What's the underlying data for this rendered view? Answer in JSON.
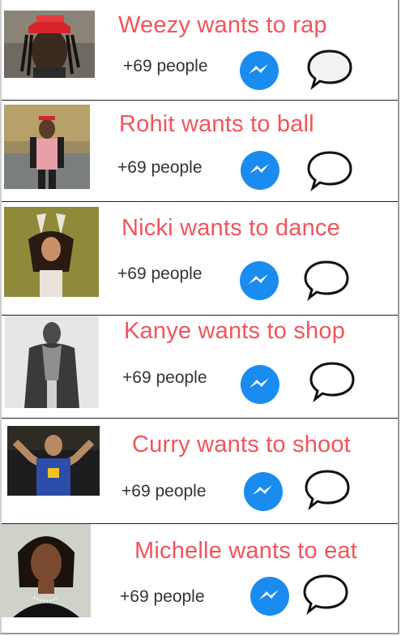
{
  "feed": {
    "items": [
      {
        "title": "Weezy wants to rap",
        "count": "+69 people",
        "avatar_icon": "person-photo"
      },
      {
        "title": "Rohit wants to ball",
        "count": "+69 people",
        "avatar_icon": "person-photo"
      },
      {
        "title": "Nicki wants to dance",
        "count": "+69 people",
        "avatar_icon": "person-photo"
      },
      {
        "title": "Kanye wants to shop",
        "count": "+69 people",
        "avatar_icon": "person-photo"
      },
      {
        "title": "Curry wants to shoot",
        "count": "+69 people",
        "avatar_icon": "person-photo"
      },
      {
        "title": "Michelle wants to eat",
        "count": "+69 people",
        "avatar_icon": "person-photo"
      }
    ]
  },
  "colors": {
    "title": "#f2545b",
    "messenger_blue": "#1a8cf0",
    "divider": "#222222"
  },
  "icons": {
    "messenger": "messenger-icon",
    "comment": "speech-bubble-icon"
  }
}
